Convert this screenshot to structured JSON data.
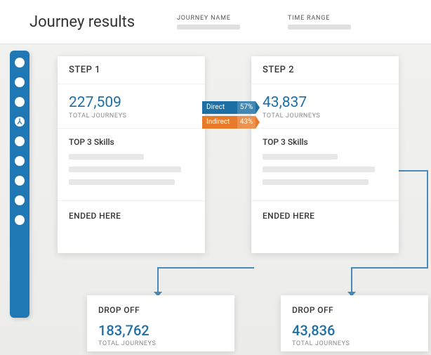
{
  "header": {
    "title": "Journey results",
    "fields": {
      "journey_name_label": "JOURNEY NAME",
      "time_range_label": "TIME RANGE"
    }
  },
  "rail": {
    "active_index": 3,
    "count": 9
  },
  "transition": {
    "direct_label": "Direct",
    "direct_pct": "57%",
    "indirect_label": "Indirect",
    "indirect_pct": "43%"
  },
  "steps": [
    {
      "title": "STEP 1",
      "value": "227,509",
      "value_label": "TOTAL JOURNEYS",
      "skills_title": "TOP 3 Skills",
      "ended_label": "ENDED HERE",
      "dropoff": {
        "title": "DROP OFF",
        "value": "183,762",
        "value_label": "TOTAL JOURNEYS"
      }
    },
    {
      "title": "STEP 2",
      "value": "43,837",
      "value_label": "TOTAL JOURNEYS",
      "skills_title": "TOP 3 Skills",
      "ended_label": "ENDED HERE",
      "dropoff": {
        "title": "DROP OFF",
        "value": "43,836",
        "value_label": "TOTAL JOURNEYS"
      }
    }
  ]
}
